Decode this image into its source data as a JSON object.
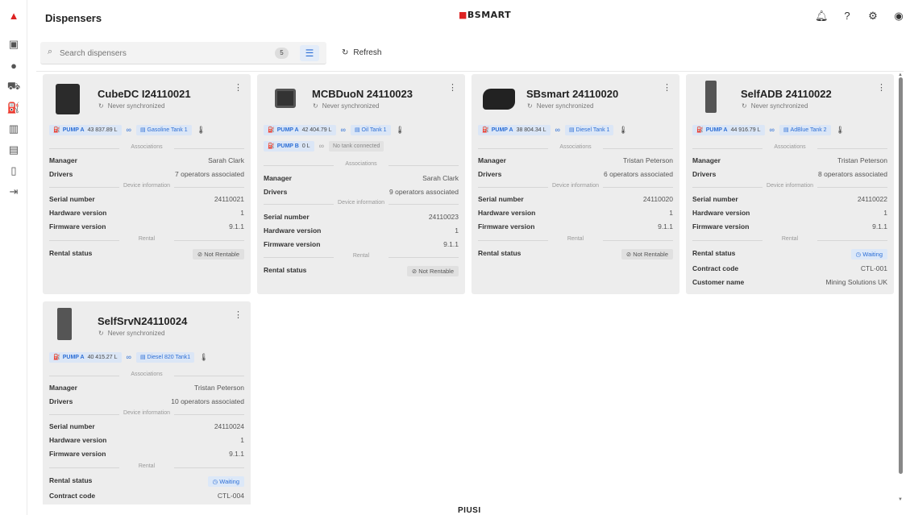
{
  "header": {
    "title": "Dispensers",
    "logo": "BSMART",
    "logo_prefix": "■"
  },
  "toolbar": {
    "search_placeholder": "Search dispensers",
    "count": "5",
    "refresh_label": "Refresh"
  },
  "icons": {
    "rail": [
      "brand-icon",
      "dispenser-station-icon",
      "user-icon",
      "truck-icon",
      "pump-icon",
      "bar-chart-icon",
      "tank-icon",
      "map-icon",
      "logout-icon"
    ],
    "top": [
      "bell-icon",
      "help-icon",
      "settings-icon",
      "account-icon"
    ]
  },
  "labels": {
    "never_sync": "Never synchronized",
    "associations": "Associations",
    "device_info": "Device information",
    "rental": "Rental",
    "manager": "Manager",
    "drivers": "Drivers",
    "serial": "Serial number",
    "hardware": "Hardware version",
    "firmware": "Firmware version",
    "rental_status": "Rental status",
    "contract_code": "Contract code",
    "customer_name": "Customer name"
  },
  "cards": [
    {
      "name": "CubeDC I24110021",
      "pumps": [
        {
          "label": "PUMP A",
          "volume": "43 837.89 L",
          "tank": "Gasoline Tank 1"
        }
      ],
      "manager": "Sarah Clark",
      "drivers": "7 operators associated",
      "serial": "24110021",
      "hardware": "1",
      "firmware": "9.1.1",
      "rental_status": "Not Rentable"
    },
    {
      "name": "MCBDuoN 24110023",
      "pumps": [
        {
          "label": "PUMP A",
          "volume": "42 404.79 L",
          "tank": "Oil Tank 1"
        },
        {
          "label": "PUMP B",
          "volume": "0 L",
          "tank": "No tank connected"
        }
      ],
      "manager": "Sarah Clark",
      "drivers": "9 operators associated",
      "serial": "24110023",
      "hardware": "1",
      "firmware": "9.1.1",
      "rental_status": "Not Rentable"
    },
    {
      "name": "SBsmart 24110020",
      "pumps": [
        {
          "label": "PUMP A",
          "volume": "38 804.34 L",
          "tank": "Diesel Tank 1"
        }
      ],
      "manager": "Tristan Peterson",
      "drivers": "6 operators associated",
      "serial": "24110020",
      "hardware": "1",
      "firmware": "9.1.1",
      "rental_status": "Not Rentable"
    },
    {
      "name": "SelfADB 24110022",
      "pumps": [
        {
          "label": "PUMP A",
          "volume": "44 916.79 L",
          "tank": "AdBlue Tank 2"
        }
      ],
      "manager": "Tristan Peterson",
      "drivers": "8 operators associated",
      "serial": "24110022",
      "hardware": "1",
      "firmware": "9.1.1",
      "rental_status": "Waiting",
      "contract_code": "CTL-001",
      "customer_name": "Mining Solutions UK"
    },
    {
      "name": "SelfSrvN24110024",
      "pumps": [
        {
          "label": "PUMP A",
          "volume": "40 415.27 L",
          "tank": "Diesel 820 Tank1"
        }
      ],
      "manager": "Tristan Peterson",
      "drivers": "10 operators associated",
      "serial": "24110024",
      "hardware": "1",
      "firmware": "9.1.1",
      "rental_status": "Waiting",
      "contract_code": "CTL-004"
    }
  ],
  "footer": {
    "brand": "PIUSI"
  }
}
